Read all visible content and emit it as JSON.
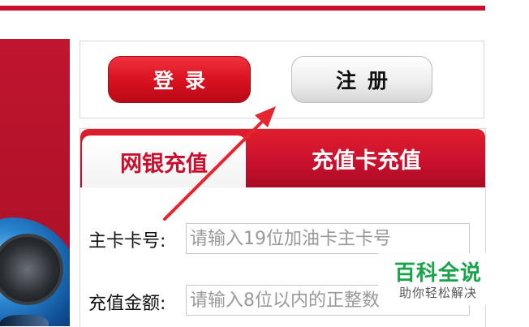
{
  "auth": {
    "login_label": "登录",
    "register_label": "注册"
  },
  "tabs": [
    {
      "label": "网银充值",
      "active": true
    },
    {
      "label": "充值卡充值",
      "active": false
    }
  ],
  "form": {
    "card_number": {
      "label": "主卡卡号:",
      "placeholder": "请输入19位加油卡主卡号"
    },
    "amount": {
      "label": "充值金额:",
      "placeholder": "请输入8位以内的正整数"
    }
  },
  "watermark": {
    "title": "百科全说",
    "subtitle": "助你轻松解决"
  },
  "colors": {
    "brand_red": "#c8102e",
    "watermark_green": "#1aa34a",
    "annotation_arrow": "#e3262f"
  }
}
